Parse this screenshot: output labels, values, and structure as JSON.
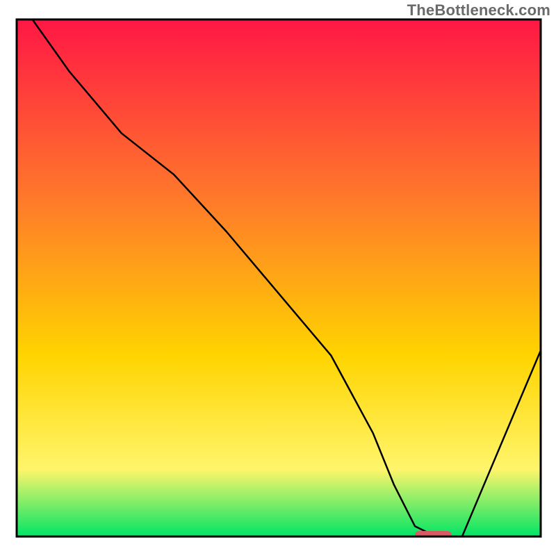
{
  "watermark": "TheBottleneck.com",
  "colors": {
    "gradient_top": "#ff1745",
    "gradient_mid1": "#ff7a2a",
    "gradient_mid2": "#ffd400",
    "gradient_mid3": "#fff56b",
    "gradient_bottom": "#00e565",
    "line": "#000000",
    "marker": "#d85a62",
    "frame": "#000000"
  },
  "chart_data": {
    "type": "line",
    "title": "",
    "xlabel": "",
    "ylabel": "",
    "xlim": [
      0,
      100
    ],
    "ylim": [
      0,
      100
    ],
    "legend": false,
    "grid": false,
    "x": [
      3,
      10,
      20,
      30,
      40,
      50,
      60,
      68,
      72,
      76,
      80,
      85,
      90,
      95,
      100
    ],
    "values": [
      100,
      90,
      78,
      70,
      59,
      47,
      35,
      20,
      10,
      2,
      0,
      0,
      12,
      24,
      36
    ],
    "marker": {
      "x_start": 76,
      "x_end": 83,
      "y": 0
    },
    "notes": "Bottleneck-style curve: steep descent from top-left, flat minimum around x≈76–83, then rises toward the right. Background is a vertical heat gradient red→orange→yellow→green."
  }
}
